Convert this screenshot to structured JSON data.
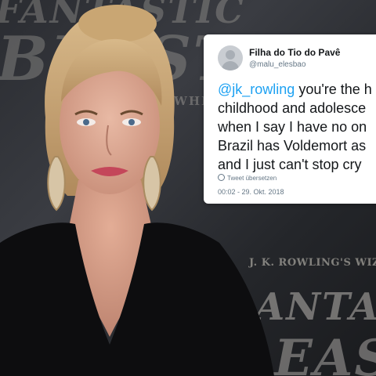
{
  "backdrop": {
    "line1": "FANTASTIC",
    "line2": "BEASTS",
    "line3": "WHE ND TH",
    "line4": "J. K. ROWLING'S WIZARDIN",
    "line5": "ANTASTIC",
    "line6": "EASTS"
  },
  "tweet": {
    "display_name": "Filha do Tio do Pavê",
    "handle": "@malu_elesbao",
    "mention": "@jk_rowling",
    "line1_rest": " you're the h",
    "line2": "childhood and adolesce",
    "line3": "when I say I have no on",
    "line4": "Brazil has Voldemort as",
    "line5": "and I just can't stop cry",
    "translate_label": "Tweet übersetzen",
    "timestamp": "00:02 - 29. Okt. 2018"
  },
  "colors": {
    "mention": "#1da1f2",
    "card_bg": "#ffffff",
    "dress": "#0d0d0f",
    "backdrop": "#2a2c31"
  }
}
